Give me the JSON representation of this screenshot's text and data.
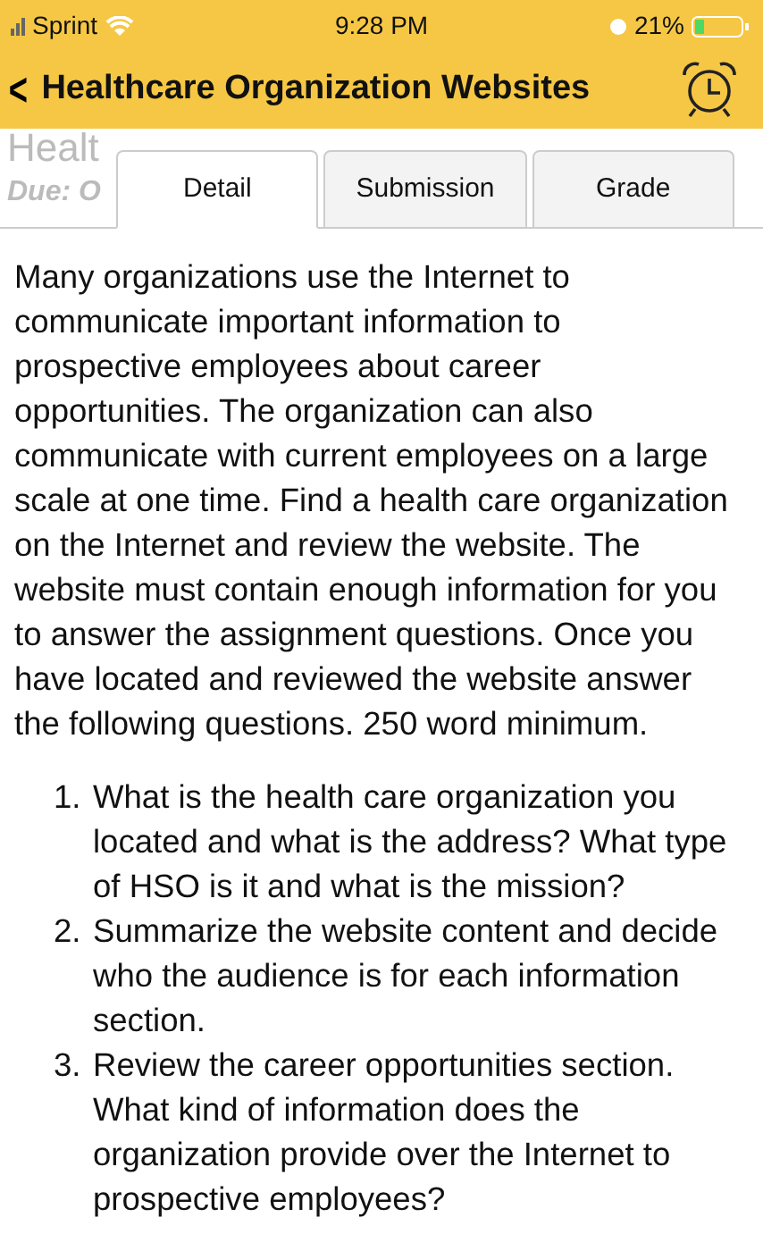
{
  "status_bar": {
    "carrier": "Sprint",
    "time": "9:28 PM",
    "battery": "21%"
  },
  "header": {
    "back": "<",
    "title": "Healthcare Organization Websites"
  },
  "assignment": {
    "title_fragment": "Healt",
    "due_fragment": "Due: O"
  },
  "tabs": [
    {
      "label": "Detail",
      "selected": true
    },
    {
      "label": "Submission",
      "selected": false
    },
    {
      "label": "Grade",
      "selected": false
    }
  ],
  "description": "Many organizations use the Internet to communicate important information to prospective employees about career opportunities. The organization can also communicate with current employees on a large scale at one time. Find a health care organization on the Internet and review the website. The website must contain enough information for you to answer the assignment questions. Once you have located and reviewed the website answer the following questions.  250 word minimum.",
  "questions": [
    {
      "number": "1.",
      "text": "What is the health care organization you located and what is the address? What type of HSO is it and what is the mission?"
    },
    {
      "number": "2.",
      "text": "Summarize the website content and decide who the audience is for each information section."
    },
    {
      "number": "3.",
      "text": "Review the career opportunities section. What kind of information does the organization provide over the Internet to prospective employees?"
    }
  ]
}
